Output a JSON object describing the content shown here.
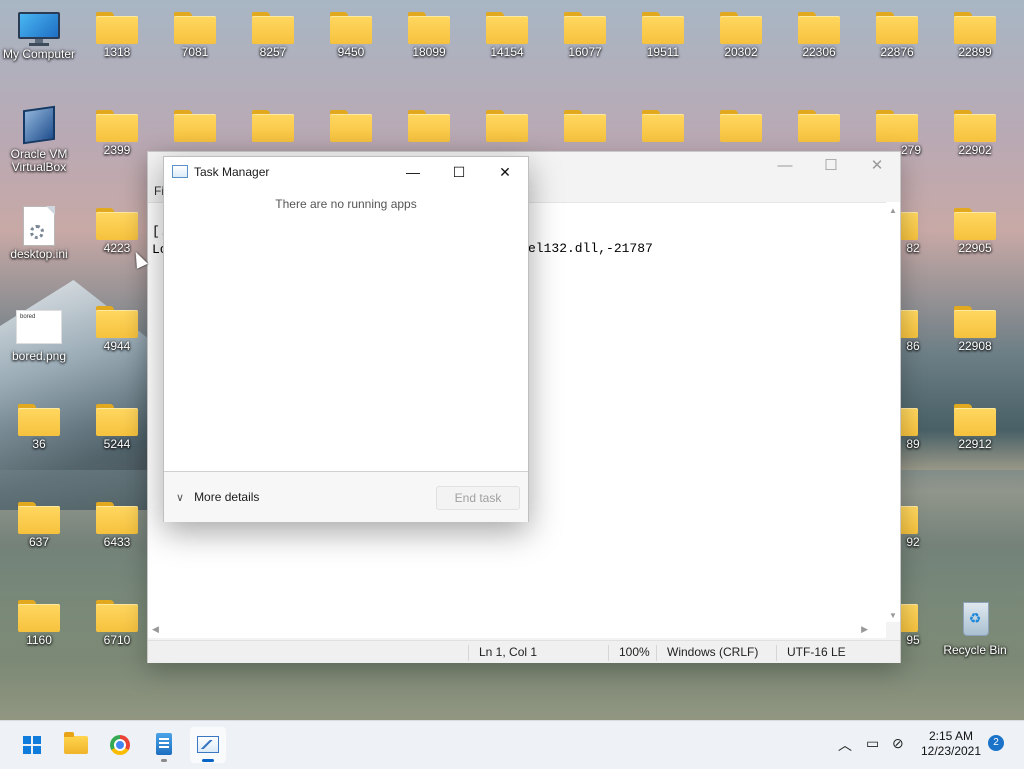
{
  "desktop": {
    "row1": [
      "My Computer",
      "1318",
      "7081",
      "8257",
      "9450",
      "18099",
      "14154",
      "16077",
      "19511",
      "20302",
      "22306",
      "22876",
      "22899"
    ],
    "row2": [
      "Oracle VM VirtualBox",
      "2399",
      "22902"
    ],
    "row2_partial": "279",
    "row3": [
      "desktop.ini",
      "4223",
      "22905"
    ],
    "row3_partial": "82",
    "row4": [
      "bored.png",
      "4944",
      "22908"
    ],
    "row4_partial": "86",
    "row5": [
      "36",
      "5244",
      "22912"
    ],
    "row5_partial": "89",
    "row6": [
      "637",
      "6433"
    ],
    "row6_partial": "92",
    "row7": [
      "1160",
      "6710",
      "Recycle Bin"
    ],
    "row7_partial": "95",
    "bored_thumb_text": "bored"
  },
  "notepad": {
    "menu_partial": "Fi",
    "line1": "[.",
    "line2": "Lo",
    "line2_tail": "el132.dll,-21787",
    "status": {
      "position": "Ln 1, Col 1",
      "zoom": "100%",
      "line_ending": "Windows (CRLF)",
      "encoding": "UTF-16 LE"
    }
  },
  "task_manager": {
    "title": "Task Manager",
    "message": "There are no running apps",
    "more_details": "More details",
    "end_task": "End task"
  },
  "taskbar": {
    "time": "2:15 AM",
    "date": "12/23/2021",
    "notifications": "2"
  }
}
